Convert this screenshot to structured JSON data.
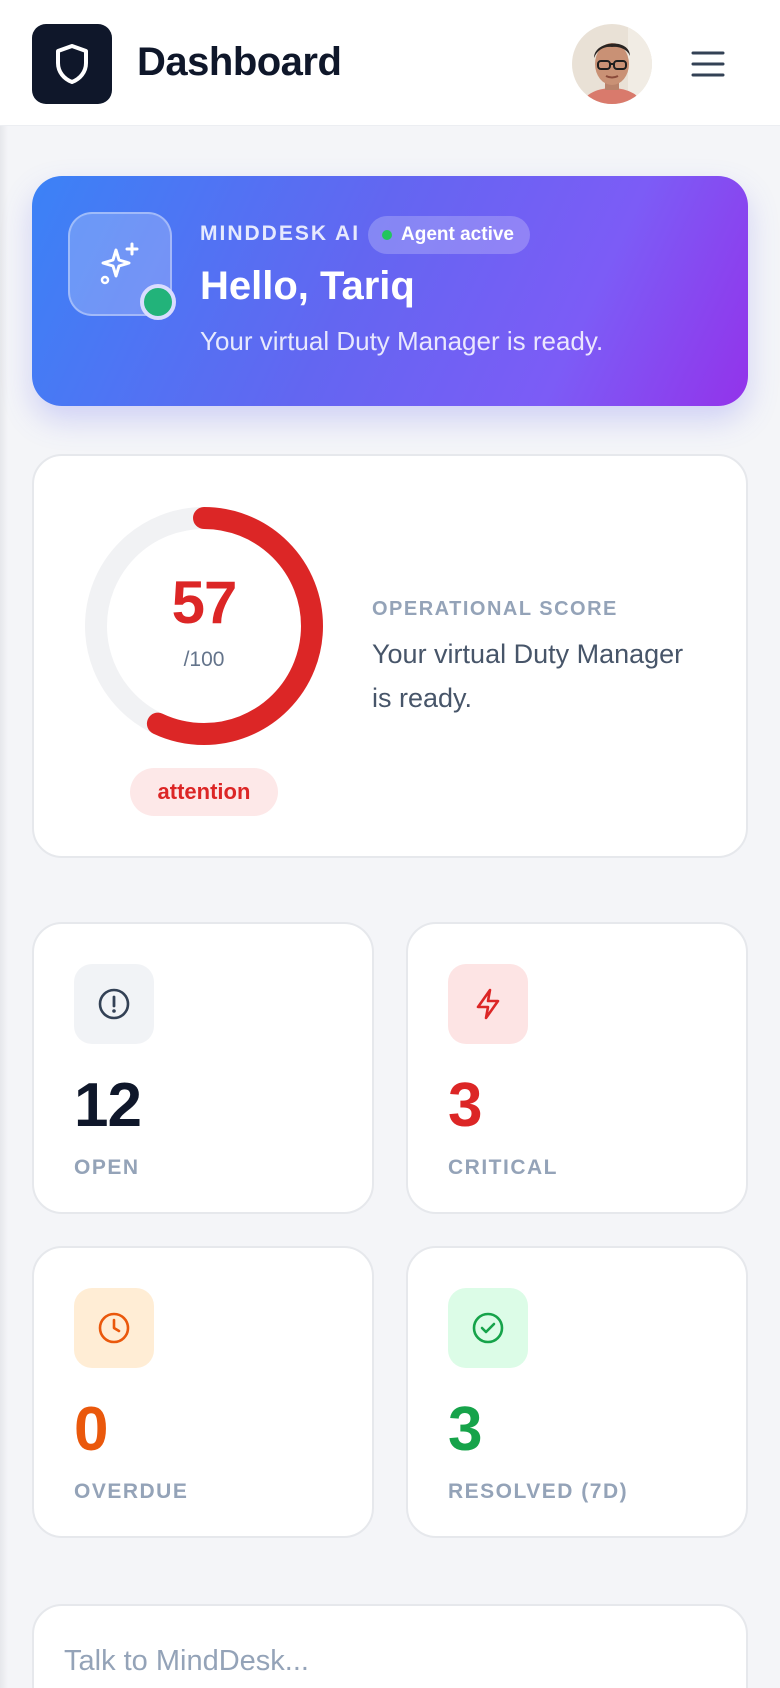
{
  "header": {
    "title": "Dashboard",
    "logo_icon": "shield-icon",
    "avatar_icon": "user-avatar",
    "menu_icon": "hamburger-menu-icon"
  },
  "hero": {
    "brand": "MINDDESK AI",
    "badge": "Agent active",
    "greeting": "Hello, Tariq",
    "subtitle": "Your virtual Duty Manager is ready.",
    "icon": "sparkles-icon",
    "status_color": "#22b37a"
  },
  "score": {
    "value": "57",
    "max": "/100",
    "fraction": 0.57,
    "status": "attention",
    "label": "OPERATIONAL SCORE",
    "text": "Your virtual Duty Manager is ready.",
    "color": "#dc2626"
  },
  "stats": [
    {
      "value": "12",
      "label": "OPEN",
      "icon": "alert-circle-icon",
      "color": "#0f172a",
      "bg": "#f1f3f6"
    },
    {
      "value": "3",
      "label": "CRITICAL",
      "icon": "lightning-icon",
      "color": "#dc2626",
      "bg": "#fde4e4"
    },
    {
      "value": "0",
      "label": "OVERDUE",
      "icon": "clock-icon",
      "color": "#ea580c",
      "bg": "#ffedd5"
    },
    {
      "value": "3",
      "label": "RESOLVED (7D)",
      "icon": "check-circle-icon",
      "color": "#16a34a",
      "bg": "#dcfce7"
    }
  ],
  "chat": {
    "placeholder": "Talk to MindDesk..."
  }
}
